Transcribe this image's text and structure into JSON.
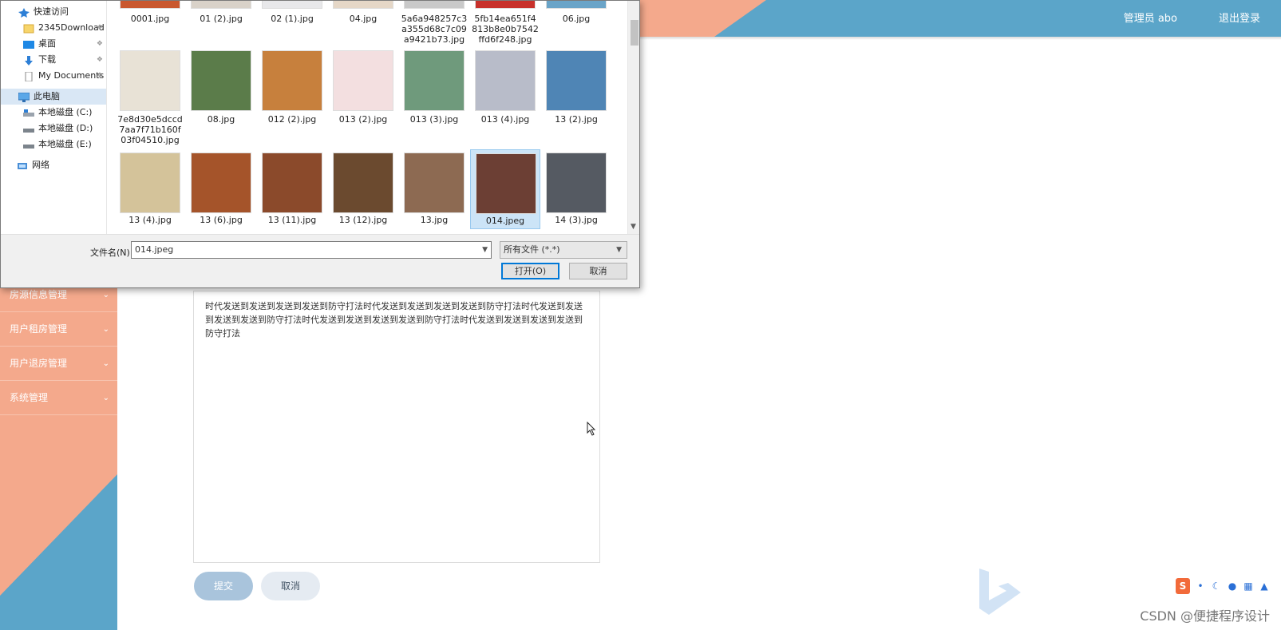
{
  "header": {
    "user_label": "管理员 abo",
    "logout_label": "退出登录"
  },
  "sidebar": {
    "items": [
      {
        "label": "房源信息管理"
      },
      {
        "label": "用户租房管理"
      },
      {
        "label": "用户退房管理"
      },
      {
        "label": "系统管理"
      }
    ]
  },
  "editor": {
    "content": "时代发送到发送到发送到发送到防守打法时代发送到发送到发送到发送到防守打法时代发送到发送到发送到发送到防守打法时代发送到发送到发送到发送到防守打法时代发送到发送到发送到发送到防守打法"
  },
  "buttons": {
    "submit": "提交",
    "cancel": "取消"
  },
  "dialog": {
    "nav": [
      {
        "label": "快速访问",
        "icon": "star-icon"
      },
      {
        "label": "2345Download",
        "icon": "folder-icon",
        "pinned": true
      },
      {
        "label": "桌面",
        "icon": "desktop-icon",
        "pinned": true
      },
      {
        "label": "下载",
        "icon": "download-icon",
        "pinned": true
      },
      {
        "label": "My Documents",
        "icon": "document-icon",
        "pinned": true
      },
      {
        "label": "此电脑",
        "icon": "computer-icon"
      },
      {
        "label": "本地磁盘 (C:)",
        "icon": "drive-icon"
      },
      {
        "label": "本地磁盘 (D:)",
        "icon": "drive-icon"
      },
      {
        "label": "本地磁盘 (E:)",
        "icon": "drive-icon"
      },
      {
        "label": "网络",
        "icon": "network-icon"
      }
    ],
    "files": [
      {
        "name": "0001.jpg"
      },
      {
        "name": "01 (2).jpg"
      },
      {
        "name": "02 (1).jpg"
      },
      {
        "name": "04.jpg"
      },
      {
        "name": "5a6a948257c3a355d68c7c09a9421b73.jpg"
      },
      {
        "name": "5fb14ea651f4813b8e0b7542ffd6f248.jpg"
      },
      {
        "name": "06.jpg"
      },
      {
        "name": "7e8d30e5dccd7aa7f71b160f03f04510.jpg"
      },
      {
        "name": "08.jpg"
      },
      {
        "name": "012 (2).jpg"
      },
      {
        "name": "013 (2).jpg"
      },
      {
        "name": "013 (3).jpg"
      },
      {
        "name": "013 (4).jpg"
      },
      {
        "name": "13 (2).jpg"
      },
      {
        "name": "13 (4).jpg"
      },
      {
        "name": "13 (6).jpg"
      },
      {
        "name": "13 (11).jpg"
      },
      {
        "name": "13 (12).jpg"
      },
      {
        "name": "13.jpg"
      },
      {
        "name": "014.jpeg"
      },
      {
        "name": "14 (3).jpg"
      }
    ],
    "filename_label": "文件名(N):",
    "filename_value": "014.jpeg",
    "filetype_value": "所有文件 (*.*)",
    "open_label": "打开(O)",
    "cancel_label": "取消"
  },
  "watermark": "CSDN @便捷程序设计",
  "ime": {
    "logo": "S"
  }
}
